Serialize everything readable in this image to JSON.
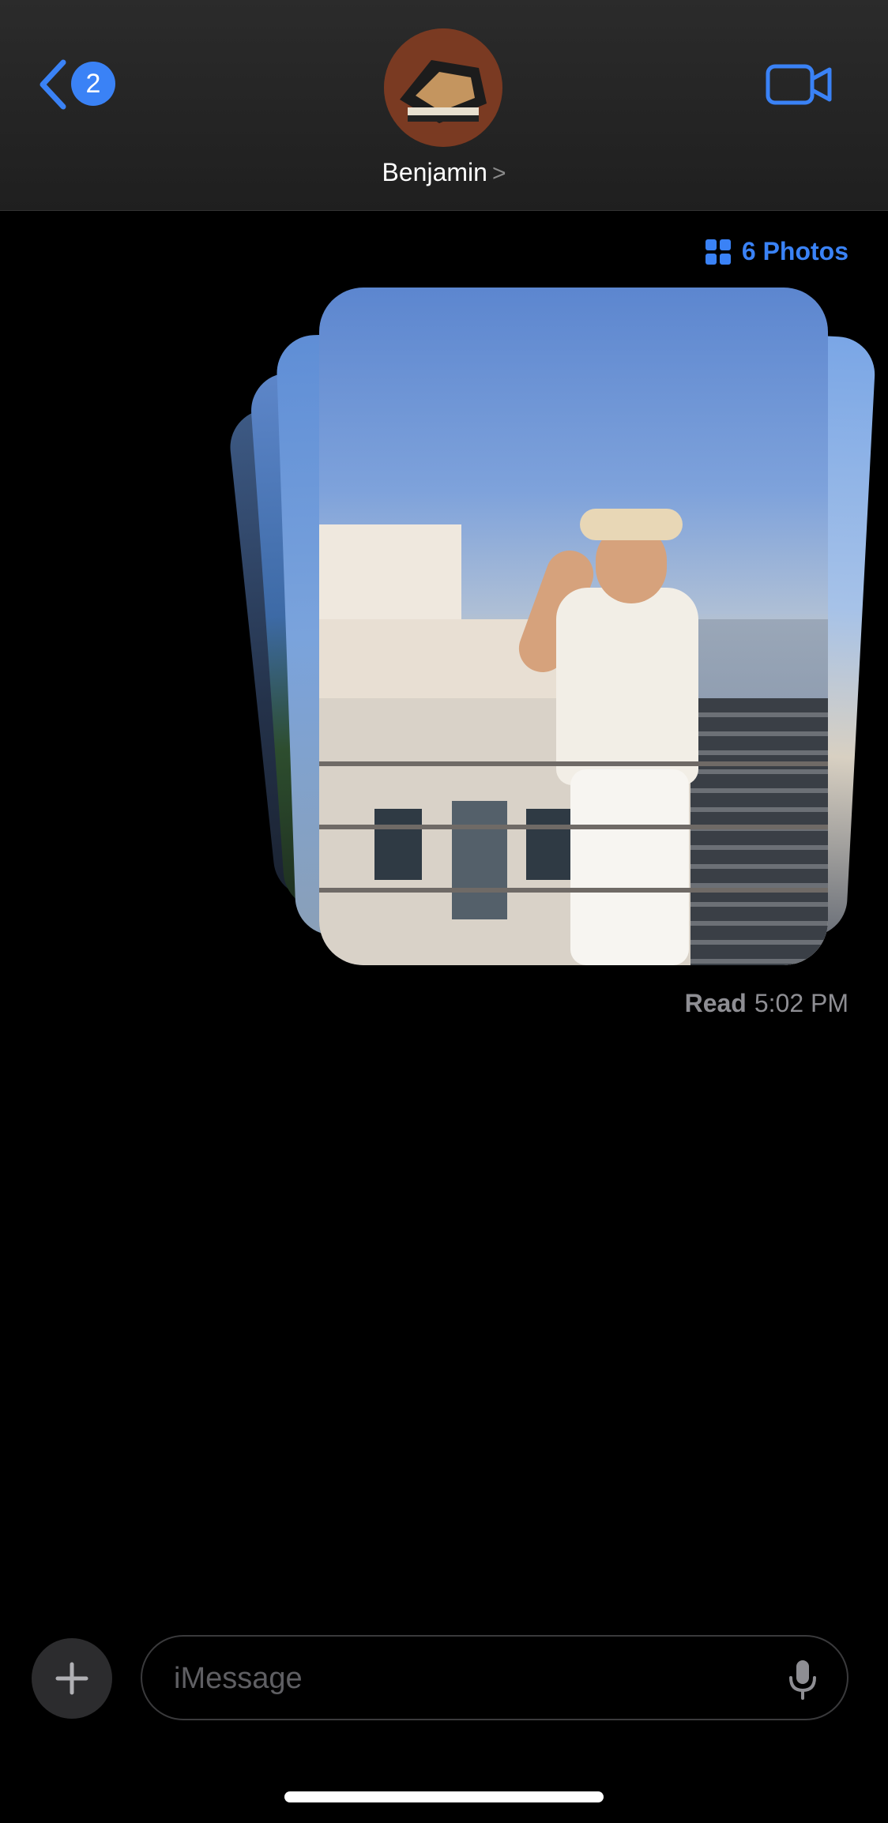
{
  "header": {
    "back_badge_count": "2",
    "contact_name": "Benjamin",
    "name_chevron": ">"
  },
  "conversation": {
    "photos_link_label": "6 Photos",
    "read_label": "Read",
    "read_time": "5:02 PM"
  },
  "composer": {
    "placeholder": "iMessage",
    "value": ""
  },
  "colors": {
    "accent": "#3a82f6",
    "background": "#000000",
    "secondary_text": "#8e8e93"
  },
  "icons": [
    "back-chevron-icon",
    "video-camera-icon",
    "photo-grid-icon",
    "plus-icon",
    "microphone-icon"
  ]
}
